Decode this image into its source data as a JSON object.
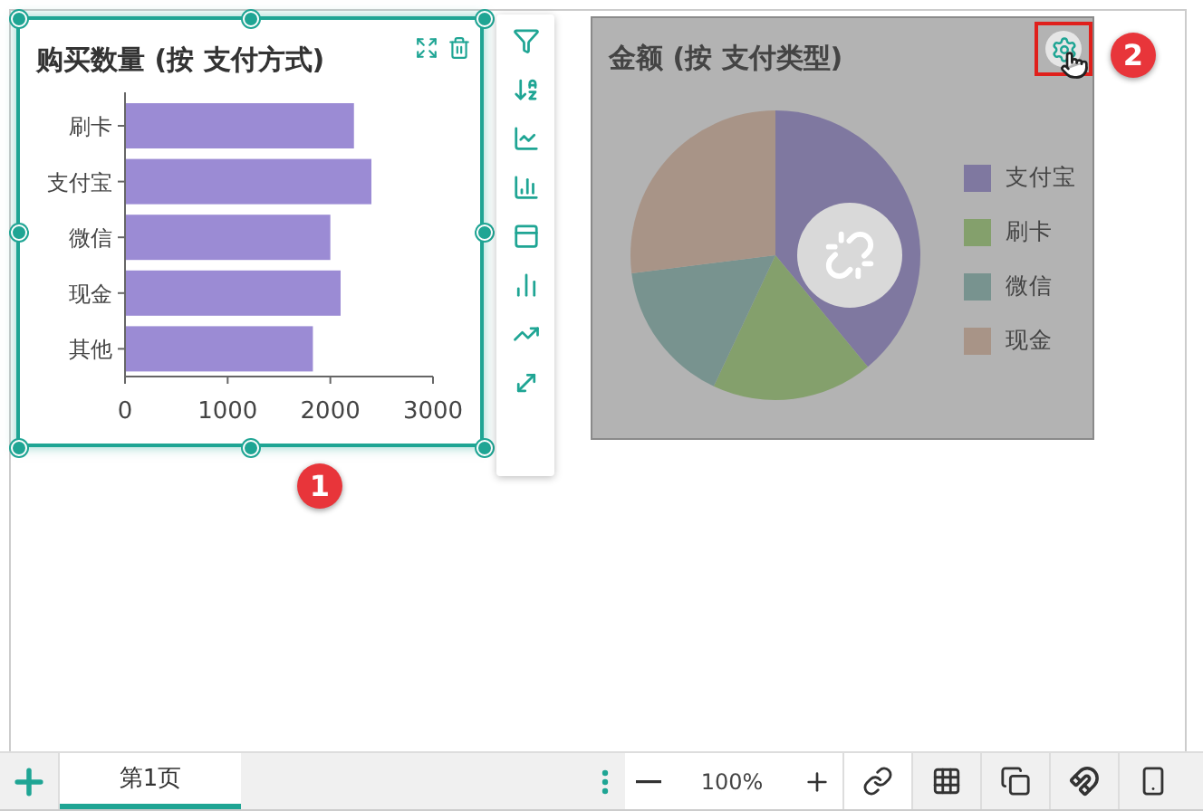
{
  "bar_panel": {
    "title": "购买数量 (按 支付方式)",
    "selected": true,
    "chart_data": {
      "type": "bar",
      "orientation": "horizontal",
      "categories": [
        "刷卡",
        "支付宝",
        "微信",
        "现金",
        "其他"
      ],
      "values": [
        2230,
        2400,
        2000,
        2100,
        1830
      ],
      "xlim": [
        0,
        3000
      ],
      "xticks": [
        0,
        1000,
        2000,
        3000
      ]
    }
  },
  "pie_panel": {
    "title": "金额 (按 支付类型)",
    "disabled": true,
    "settings_highlighted": true,
    "legend": [
      {
        "color": "#7f78a0"
      },
      {
        "color": "#84a06c"
      },
      {
        "color": "#78938f"
      },
      {
        "color": "#a89487"
      }
    ],
    "chart_data": {
      "type": "pie",
      "categories": [
        "支付宝",
        "刷卡",
        "微信",
        "现金"
      ],
      "values": [
        39,
        18,
        16,
        27
      ]
    }
  },
  "callouts": [
    {
      "label": "1"
    },
    {
      "label": "2"
    }
  ],
  "page_tabs": [
    {
      "label": "第1页",
      "selected": true
    }
  ],
  "zoom": "100%"
}
